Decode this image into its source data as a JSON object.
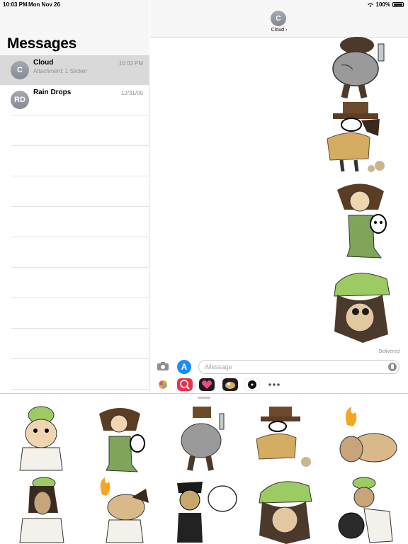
{
  "status": {
    "time": "10:03 PM",
    "date": "Mon Nov 26",
    "battery": "100%"
  },
  "sidebar": {
    "title": "Messages",
    "conversations": [
      {
        "initials": "C",
        "name": "Cloud",
        "preview": "Attachment: 1 Sticker",
        "time": "10:03 PM",
        "selected": true
      },
      {
        "initials": "RD",
        "name": "Rain Drops",
        "preview": "",
        "time": "12/31/00",
        "selected": false
      }
    ]
  },
  "conversation": {
    "initial": "C",
    "name": "Cloud ›",
    "status": "Delivered",
    "stickers": [
      "walking-bag-character-sticker",
      "hat-creature-sticker",
      "girl-with-skull-sticker",
      "green-hat-character-sticker"
    ]
  },
  "compose": {
    "placeholder": "iMessage",
    "apps": [
      "camera-icon",
      "app-store-icon",
      "photos-icon",
      "search-globe-icon",
      "heart-app-icon",
      "sticker-pack-icon",
      "music-icon",
      "more-icon"
    ]
  },
  "tray": {
    "stickers": [
      "green-beanie-guy",
      "girl-with-skull",
      "walking-bag-character",
      "hat-creature-steam",
      "barrel-hand",
      "mustache-guy",
      "fire-barrel-character",
      "zombie-speech-bubble",
      "green-hat-character",
      "globe-chef"
    ]
  },
  "colors": {
    "selected_row": "#d9d9d9",
    "accent": "#1a8cff",
    "secondary_text": "#8e8e93"
  }
}
